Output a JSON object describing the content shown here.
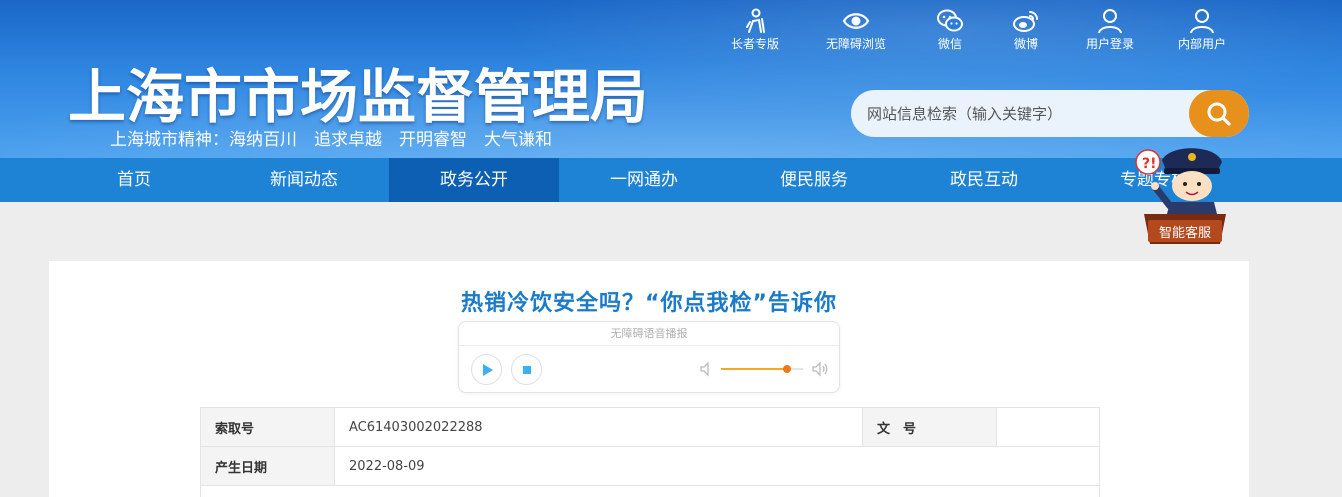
{
  "header": {
    "title": "上海市市场监督管理局",
    "slogan": "上海城市精神：海纳百川　追求卓越　开明睿智　大气谦和",
    "toolbar": [
      {
        "label": "长者专版",
        "icon": "elder-icon"
      },
      {
        "label": "无障碍浏览",
        "icon": "eye-icon"
      },
      {
        "label": "微信",
        "icon": "wechat-icon"
      },
      {
        "label": "微博",
        "icon": "weibo-icon"
      },
      {
        "label": "用户登录",
        "icon": "user-icon"
      },
      {
        "label": "内部用户",
        "icon": "user-icon"
      }
    ],
    "search": {
      "placeholder": "网站信息检索（输入关键字）",
      "button_icon": "search-icon"
    }
  },
  "nav": {
    "items": [
      {
        "label": "首页"
      },
      {
        "label": "新闻动态"
      },
      {
        "label": "政务公开",
        "active": true
      },
      {
        "label": "一网通办"
      },
      {
        "label": "便民服务"
      },
      {
        "label": "政民互动"
      },
      {
        "label": "专题专栏"
      }
    ]
  },
  "mascot": {
    "label": "智能客服"
  },
  "article": {
    "title": "热销冷饮安全吗？“你点我检”告诉你",
    "audio": {
      "header": "无障碍语音播报",
      "volume": 0.8
    },
    "meta": {
      "index_label": "索取号",
      "index_value": "AC61403002022288",
      "docno_label": "文　号",
      "docno_value": "",
      "date_label": "产生日期",
      "date_value": "2022-08-09"
    }
  },
  "colors": {
    "header_blue": "#1a67c7",
    "nav_blue": "#1e83d4",
    "nav_active": "#0d5fb4",
    "title_blue": "#1b7bc8",
    "search_orange": "#e8901c",
    "play_blue": "#3ab0f0"
  }
}
